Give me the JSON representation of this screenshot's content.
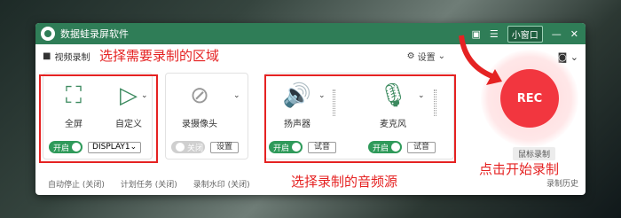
{
  "app": {
    "title": "数据蛙录屏软件",
    "mini_window": "小窗口"
  },
  "toolbar": {
    "mode": "视频录制",
    "settings": "设置"
  },
  "screen_cards": {
    "full": {
      "label": "全屏",
      "toggle": "开启",
      "display": "DISPLAY1"
    },
    "custom": {
      "label": "自定义"
    }
  },
  "camera": {
    "label": "录摄像头",
    "toggle": "关闭",
    "button": "设置"
  },
  "speaker": {
    "label": "扬声器",
    "toggle": "开启",
    "button": "试音"
  },
  "mic": {
    "label": "麦克风",
    "toggle": "开启",
    "button": "试音"
  },
  "rec": {
    "label": "REC",
    "mouse": "鼠标录制"
  },
  "bottom": {
    "auto_stop": "自动停止 (关闭)",
    "schedule": "计划任务 (关闭)",
    "watermark": "录制水印 (关闭)",
    "history": "录制历史"
  },
  "annotations": {
    "region": "选择需要录制的区域",
    "audio": "选择录制的音频源",
    "click": "点击开始录制"
  },
  "colors": {
    "accent": "#2f7d57",
    "rec": "#f2363f",
    "annotation": "#e52222"
  }
}
